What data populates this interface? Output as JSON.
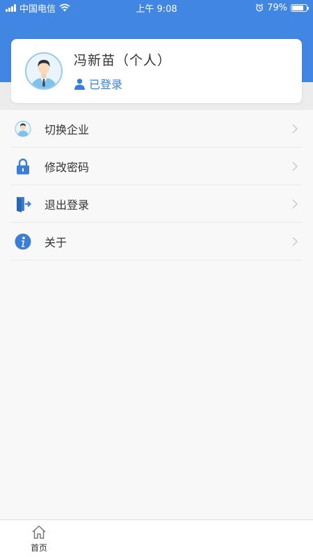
{
  "status_bar": {
    "carrier": "中国电信",
    "time": "上午 9:08",
    "battery": "79%",
    "battery_level": 0.79,
    "icons": [
      "signal-icon",
      "wifi-icon",
      "alarm-icon",
      "battery-icon"
    ]
  },
  "profile": {
    "name": "冯新苗（个人）",
    "status": "已登录",
    "icons": [
      "avatar-icon",
      "person-icon"
    ]
  },
  "menu": {
    "items": [
      {
        "label": "切换企业",
        "icon": "avatar-icon"
      },
      {
        "label": "修改密码",
        "icon": "lock-icon"
      },
      {
        "label": "退出登录",
        "icon": "exit-door-icon"
      },
      {
        "label": "关于",
        "icon": "info-icon"
      }
    ]
  },
  "tab_bar": {
    "items": [
      {
        "label": "首页",
        "icon": "home-icon"
      }
    ]
  },
  "colors": {
    "primary": "#4286e3",
    "icon_blue": "#3a7fd5",
    "text": "#333333",
    "background": "#f8f8f8"
  }
}
